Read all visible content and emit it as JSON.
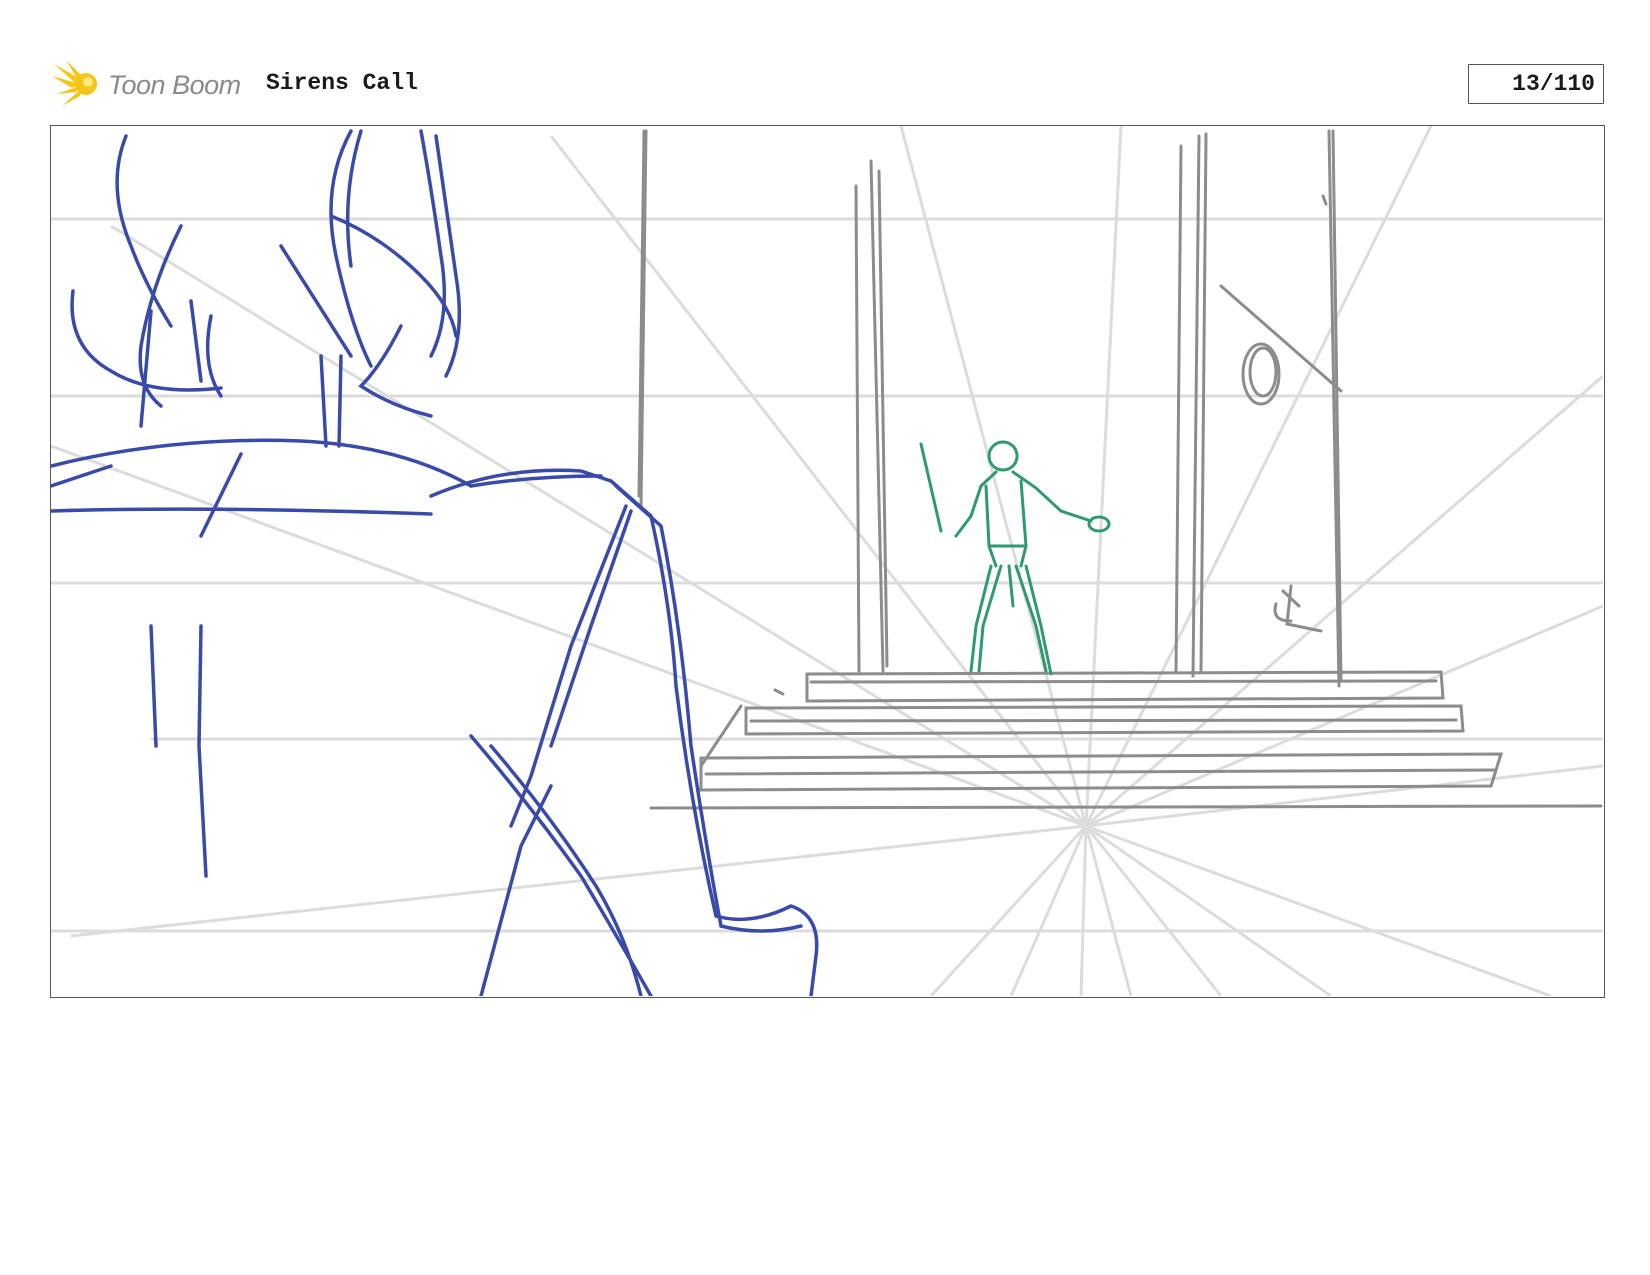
{
  "header": {
    "logo_text": "Toon Boom",
    "project_title": "Sirens Call",
    "page_counter": "13/110"
  },
  "colors": {
    "logo_yellow": "#f5c518",
    "guide_gray": "#d9d9d9",
    "set_gray": "#8c8c8c",
    "foreground_blue": "#3a4aa8",
    "character_green": "#2e9a6e"
  },
  "icons": {
    "logo": "starburst-icon"
  }
}
